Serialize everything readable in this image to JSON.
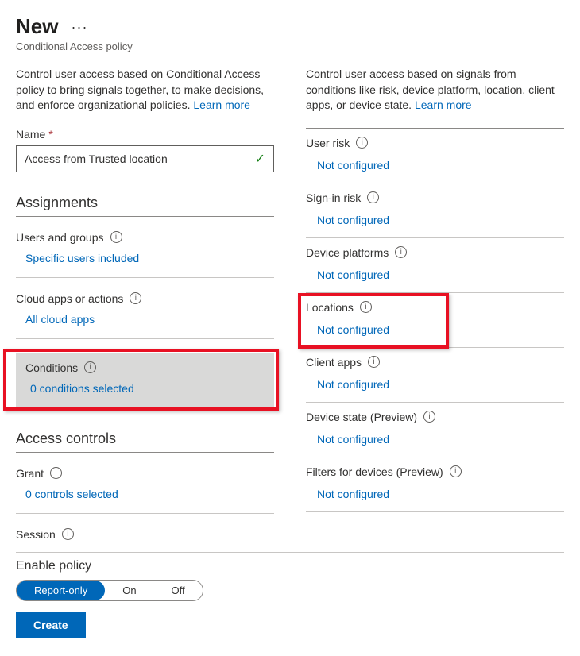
{
  "header": {
    "title": "New",
    "subtitle": "Conditional Access policy",
    "more": "···"
  },
  "left": {
    "intro": "Control user access based on Conditional Access policy to bring signals together, to make decisions, and enforce organizational policies. ",
    "learn_more": "Learn more",
    "name_label": "Name",
    "name_value": "Access from Trusted location",
    "assignments_title": "Assignments",
    "users_label": "Users and groups",
    "users_value": "Specific users included",
    "apps_label": "Cloud apps or actions",
    "apps_value": "All cloud apps",
    "conditions_label": "Conditions",
    "conditions_value": "0 conditions selected",
    "controls_title": "Access controls",
    "grant_label": "Grant",
    "grant_value": "0 controls selected",
    "session_label": "Session"
  },
  "right": {
    "intro": "Control user access based on signals from conditions like risk, device platform, location, client apps, or device state. ",
    "learn_more": "Learn more",
    "items": [
      {
        "label": "User risk",
        "value": "Not configured"
      },
      {
        "label": "Sign-in risk",
        "value": "Not configured"
      },
      {
        "label": "Device platforms",
        "value": "Not configured"
      },
      {
        "label": "Locations",
        "value": "Not configured"
      },
      {
        "label": "Client apps",
        "value": "Not configured"
      },
      {
        "label": "Device state (Preview)",
        "value": "Not configured"
      },
      {
        "label": "Filters for devices (Preview)",
        "value": "Not configured"
      }
    ]
  },
  "footer": {
    "enable_label": "Enable policy",
    "options": [
      "Report-only",
      "On",
      "Off"
    ],
    "active_index": 0,
    "create_label": "Create"
  }
}
